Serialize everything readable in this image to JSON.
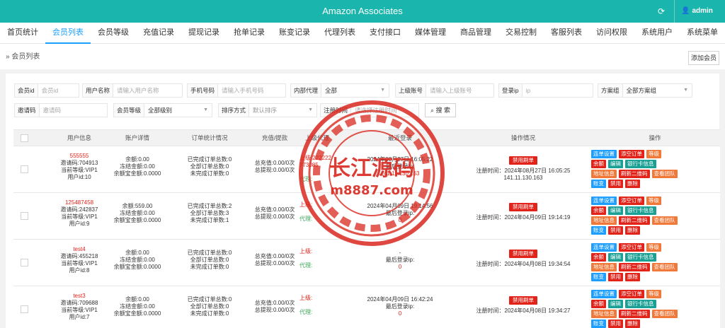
{
  "header": {
    "title": "Amazon Associates",
    "user": "admin",
    "refresh_glyph": "⟳",
    "user_glyph": "👤"
  },
  "nav": {
    "items": [
      "首页统计",
      "会员列表",
      "会员等级",
      "充值记录",
      "提现记录",
      "抢单记录",
      "账变记录",
      "代理列表",
      "支付接口",
      "媒体管理",
      "商品管理",
      "交易控制",
      "客服列表",
      "访问权限",
      "系统用户",
      "系统菜单"
    ],
    "active": "会员列表"
  },
  "breadcrumb": {
    "prefix": "»",
    "label": "会员列表"
  },
  "add_button": "添加会员",
  "filters": {
    "id": {
      "label": "会员id",
      "placeholder": "会员id"
    },
    "username": {
      "label": "用户名称",
      "placeholder": "请输入用户名称"
    },
    "phone": {
      "label": "手机号码",
      "placeholder": "请输入手机号码"
    },
    "internal_agent": {
      "label": "内部代理",
      "value": "全部"
    },
    "parent": {
      "label": "上级账号",
      "placeholder": "请输入上级账号"
    },
    "login_ip": {
      "label": "登录ip",
      "placeholder": "ip"
    },
    "plan_group": {
      "label": "方案组",
      "value": "全部方案组"
    },
    "invite": {
      "label": "邀请码",
      "placeholder": "邀请码"
    },
    "level": {
      "label": "会员等级",
      "value": "全部级别"
    },
    "sort": {
      "label": "排序方式",
      "value": "默认排序"
    },
    "register_time": {
      "label": "注册时间",
      "placeholder": "请选择注册时间"
    },
    "search": "搜 索"
  },
  "table": {
    "headers": [
      "用户信息",
      "账户详情",
      "订单统计情况",
      "充值/提款",
      "上级代理",
      "最近登录",
      "操作情况",
      "操作"
    ],
    "rows": [
      {
        "name": "555555",
        "invite": "邀请码:704913",
        "level": "当前等级:VIP1",
        "uid": "用户id:10",
        "balance": "余额:0.00",
        "frozen": "冻结金额:0.00",
        "fund": "余额宝金额:0.0000",
        "done": "已完成订单总数:0",
        "all": "全部订单总数:0",
        "undone": "未完成订单数:0",
        "recharge": "总充值:0.00/0次",
        "withdraw": "总提现:0.00/0次",
        "up": "上级:222222",
        "up2": "773085",
        "agent": "代理:",
        "login_time": "2024年08月27日 16:05:22",
        "login_ip_label": "最后登录ip:",
        "login_ip": "141.11.130.163",
        "ban": "禁用刷单",
        "reg": "注册时间：2024年08月27日 16:05:25",
        "reg_ip": "141.11.130.163"
      },
      {
        "name": "125487458",
        "invite": "邀请码:242837",
        "level": "当前等级:VIP1",
        "uid": "用户id:9",
        "balance": "余额:559.00",
        "frozen": "冻结金额:0.00",
        "fund": "余额宝金额:0.0000",
        "done": "已完成订单总数:2",
        "all": "全部订单总数:3",
        "undone": "未完成订单数:1",
        "recharge": "总充值:0.00/0次",
        "withdraw": "总提现:0.00/0次",
        "up": "上级:",
        "up2": "",
        "agent": "代理:",
        "login_time": "2024年04月09日 19:14:56",
        "login_ip_label": "最后登录ip:",
        "login_ip": "0",
        "ban": "禁用刷单",
        "reg": "注册时间：2024年04月09日 19:14:19",
        "reg_ip": ""
      },
      {
        "name": "test4",
        "invite": "邀请码:455218",
        "level": "当前等级:VIP1",
        "uid": "用户id:8",
        "balance": "余额:0.00",
        "frozen": "冻结金额:0.00",
        "fund": "余额宝金额:0.0000",
        "done": "已完成订单总数:0",
        "all": "全部订单总数:0",
        "undone": "未完成订单数:0",
        "recharge": "总充值:0.00/0次",
        "withdraw": "总提现:0.00/0次",
        "up": "上级:",
        "up2": "",
        "agent": "代理:",
        "login_time": "-",
        "login_ip_label": "最后登录ip:",
        "login_ip": "0",
        "ban": "禁用刷单",
        "reg": "注册时间：2024年04月08日 19:34:54",
        "reg_ip": ""
      },
      {
        "name": "test3",
        "invite": "邀请码:709688",
        "level": "当前等级:VIP1",
        "uid": "用户id:7",
        "balance": "余额:0.00",
        "frozen": "冻结金额:0.00",
        "fund": "余额宝金额:0.0000",
        "done": "已完成订单总数:0",
        "all": "全部订单总数:0",
        "undone": "未完成订单数:0",
        "recharge": "总充值:0.00/0次",
        "withdraw": "总提现:0.00/0次",
        "up": "上级:",
        "up2": "",
        "agent": "代理:",
        "login_time": "2024年04月09日 16:42:24",
        "login_ip_label": "最后登录ip:",
        "login_ip": "0",
        "ban": "禁用刷单",
        "reg": "注册时间：2024年04月08日 19:34:27",
        "reg_ip": ""
      }
    ],
    "ops": {
      "line1": [
        "连单设置",
        "添空订单",
        "等级"
      ],
      "line2": [
        "余额",
        "编辑",
        "银行卡信息"
      ],
      "line3": [
        "地址信息",
        "刷新二维码",
        "查看团队"
      ],
      "line4": [
        "账变",
        "禁用",
        "删除"
      ]
    }
  },
  "watermark": {
    "title": "长江源码",
    "url": "m8887.com"
  },
  "colors": {
    "header": "#1ab5ac",
    "accent": "#1e9fff",
    "danger": "#e2231a",
    "warning": "#f0793a",
    "teal": "#1aa094"
  }
}
